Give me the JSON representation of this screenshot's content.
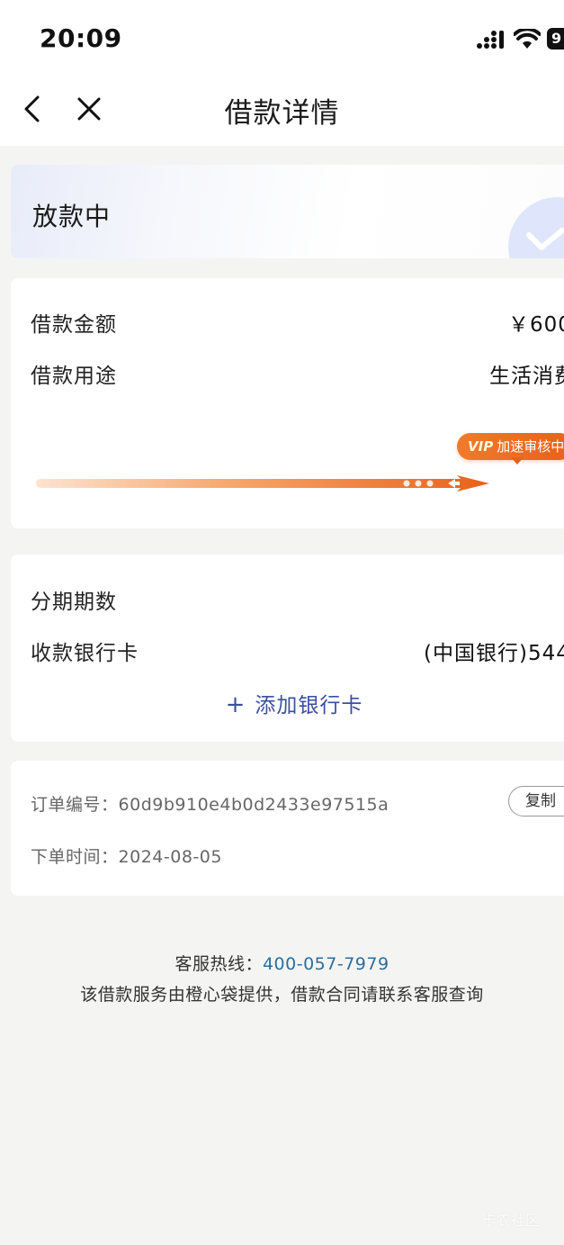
{
  "status_bar": {
    "time": "20:09",
    "battery": "9"
  },
  "nav": {
    "title": "借款详情"
  },
  "loan_status": {
    "text": "放款中"
  },
  "loan": {
    "amount_label": "借款金额",
    "amount_value": "￥600",
    "purpose_label": "借款用途",
    "purpose_value": "生活消费",
    "vip_word": "VIP",
    "vip_text": "加速审核中",
    "progress": 0.9
  },
  "bank": {
    "installments_label": "分期期数",
    "card_label": "收款银行卡",
    "card_value": "(中国银行)544",
    "add_card_label": "添加银行卡"
  },
  "order": {
    "number_label": "订单编号：",
    "number_value": "60d9b910e4b0d2433e97515a",
    "copy_label": "复制",
    "time_label": "下单时间：",
    "time_value": "2024-08-05"
  },
  "footer": {
    "hotline_label": "客服热线：",
    "hotline_number": "400-057-7979",
    "disclaimer": "该借款服务由橙心袋提供，借款合同请联系客服查询"
  },
  "watermark": "卡农社区",
  "colors": {
    "accent_orange": "#e8611a",
    "link_blue": "#3a4fa0",
    "hotline_blue": "#2c6e9c"
  }
}
